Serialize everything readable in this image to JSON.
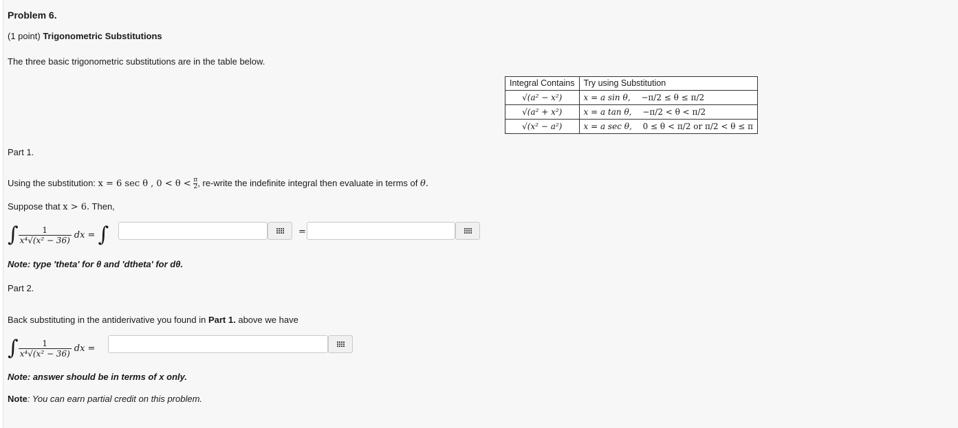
{
  "problem": {
    "title": "Problem 6.",
    "points": "(1 point)",
    "topic": "Trigonometric Substitutions",
    "intro": "The three basic trigonometric substitutions are in the table below."
  },
  "table": {
    "header_contains": "Integral Contains",
    "header_substitution": "Try using Substitution",
    "rows": [
      {
        "contains": "√(a² − x²)",
        "sub": "x = a sin θ,",
        "range": "−π/2 ≤ θ ≤ π/2"
      },
      {
        "contains": "√(a² + x²)",
        "sub": "x = a tan θ,",
        "range": "−π/2 < θ < π/2"
      },
      {
        "contains": "√(x² − a²)",
        "sub": "x = a sec θ,",
        "range": "0 ≤ θ < π/2 or π/2 < θ ≤ π"
      }
    ]
  },
  "part1": {
    "heading": "Part 1.",
    "instruction_prefix": "Using the substitution:",
    "substitution": "x = 6 sec θ , 0 < θ <",
    "instruction_suffix": ", re-write the indefinite integral then evaluate in terms of",
    "theta": "θ.",
    "suppose_prefix": "Suppose that",
    "suppose_math": "x > 6.",
    "suppose_suffix": "Then,",
    "integrand_num": "1",
    "integrand_den": "x⁴√(x² − 36)",
    "dx": "dx =",
    "input1_value": "",
    "input2_value": "",
    "equals": "=",
    "note": "Note: type 'theta' for θ and 'dtheta' for dθ."
  },
  "part2": {
    "heading": "Part 2.",
    "intro_prefix": "Back substituting in the antiderivative you found in",
    "intro_ref": "Part 1.",
    "intro_suffix": "above we have",
    "integrand_num": "1",
    "integrand_den": "x⁴√(x² − 36)",
    "dx": "dx =",
    "input_value": "",
    "note": "Note: answer should be in terms of x only."
  },
  "footer": {
    "label": "Note",
    "text": ": You can earn partial credit on this problem."
  },
  "icons": {
    "equation_editor": "grid-icon"
  }
}
